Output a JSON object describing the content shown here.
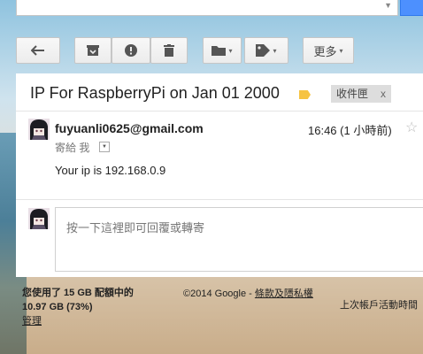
{
  "search": {
    "dropdown_glyph": "▼"
  },
  "toolbar": {
    "back_icon": "arrow-left-icon",
    "archive_icon": "archive-icon",
    "spam_icon": "report-spam-icon",
    "delete_icon": "trash-icon",
    "move_icon": "folder-icon",
    "labels_icon": "label-icon",
    "more_label": "更多",
    "caret": "▾"
  },
  "email": {
    "subject": "IP For RaspberryPi on Jan 01 2000",
    "label_color": "#f6c342",
    "inbox_label": "收件匣",
    "inbox_remove": "x",
    "sender": "fuyuanli0625@gmail.com",
    "time": "16:46 (1 小時前)",
    "star": "☆",
    "to_me": "寄給 我",
    "to_caret": "▼",
    "body": "Your ip is 192.168.0.9"
  },
  "reply": {
    "placeholder": "按一下這裡即可回覆或轉寄"
  },
  "footer": {
    "storage_line1": "您使用了 15 GB 配額中的",
    "storage_line2": "10.97 GB (73%)",
    "manage": "管理",
    "copyright": "©2014 Google - ",
    "terms": "條款及隱私權",
    "last_activity": "上次帳戶活動時間"
  },
  "colors": {
    "search_button": "#4d90fe",
    "label": "#f6c342"
  }
}
